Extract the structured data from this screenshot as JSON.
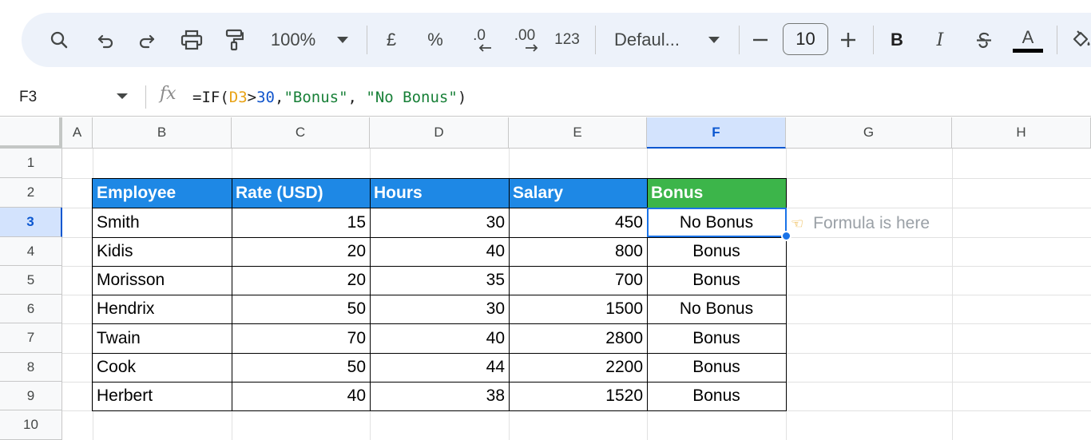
{
  "toolbar": {
    "zoom": "100%",
    "currency_symbol": "£",
    "percent_symbol": "%",
    "decrease_decimal": ".0",
    "increase_decimal": ".00",
    "number_format": "123",
    "font_name": "Defaul...",
    "font_size": "10",
    "bold_label": "B",
    "italic_label": "I",
    "text_color_label": "A",
    "icons": [
      "search-icon",
      "undo-icon",
      "redo-icon",
      "print-icon",
      "paint-format-icon",
      "chevron-down-icon",
      "minus-icon",
      "plus-icon",
      "strikethrough-icon",
      "fill-color-icon"
    ]
  },
  "formula_bar": {
    "cell_ref": "F3",
    "fx_label": "fx",
    "formula": {
      "prefix": "=IF(",
      "ref": "D3",
      "op": ">",
      "num": "30",
      "comma1": ",",
      "str1": "\"Bonus\"",
      "comma2": ", ",
      "str2": "\"No Bonus\"",
      "close": ")"
    }
  },
  "grid": {
    "columns": [
      "A",
      "B",
      "C",
      "D",
      "E",
      "F",
      "G",
      "H"
    ],
    "selected_column": "F",
    "rows": [
      "1",
      "2",
      "3",
      "4",
      "5",
      "6",
      "7",
      "8",
      "9",
      "10"
    ],
    "selected_row": "3",
    "header_colors": {
      "blue": "#1e88e5",
      "green": "#3cb54a",
      "selection": "#1a73e8"
    }
  },
  "table": {
    "headers": [
      "Employee",
      "Rate (USD)",
      "Hours",
      "Salary",
      "Bonus"
    ],
    "rows": [
      [
        "Smith",
        "15",
        "30",
        "450",
        "No Bonus"
      ],
      [
        "Kidis",
        "20",
        "40",
        "800",
        "Bonus"
      ],
      [
        "Morisson",
        "20",
        "35",
        "700",
        "Bonus"
      ],
      [
        "Hendrix",
        "50",
        "30",
        "1500",
        "No Bonus"
      ],
      [
        "Twain",
        "70",
        "40",
        "2800",
        "Bonus"
      ],
      [
        "Cook",
        "50",
        "44",
        "2200",
        "Bonus"
      ],
      [
        "Herbert",
        "40",
        "38",
        "1520",
        "Bonus"
      ]
    ]
  },
  "annotation": {
    "text": "Formula is here",
    "icon": "pointing-hand-icon"
  }
}
